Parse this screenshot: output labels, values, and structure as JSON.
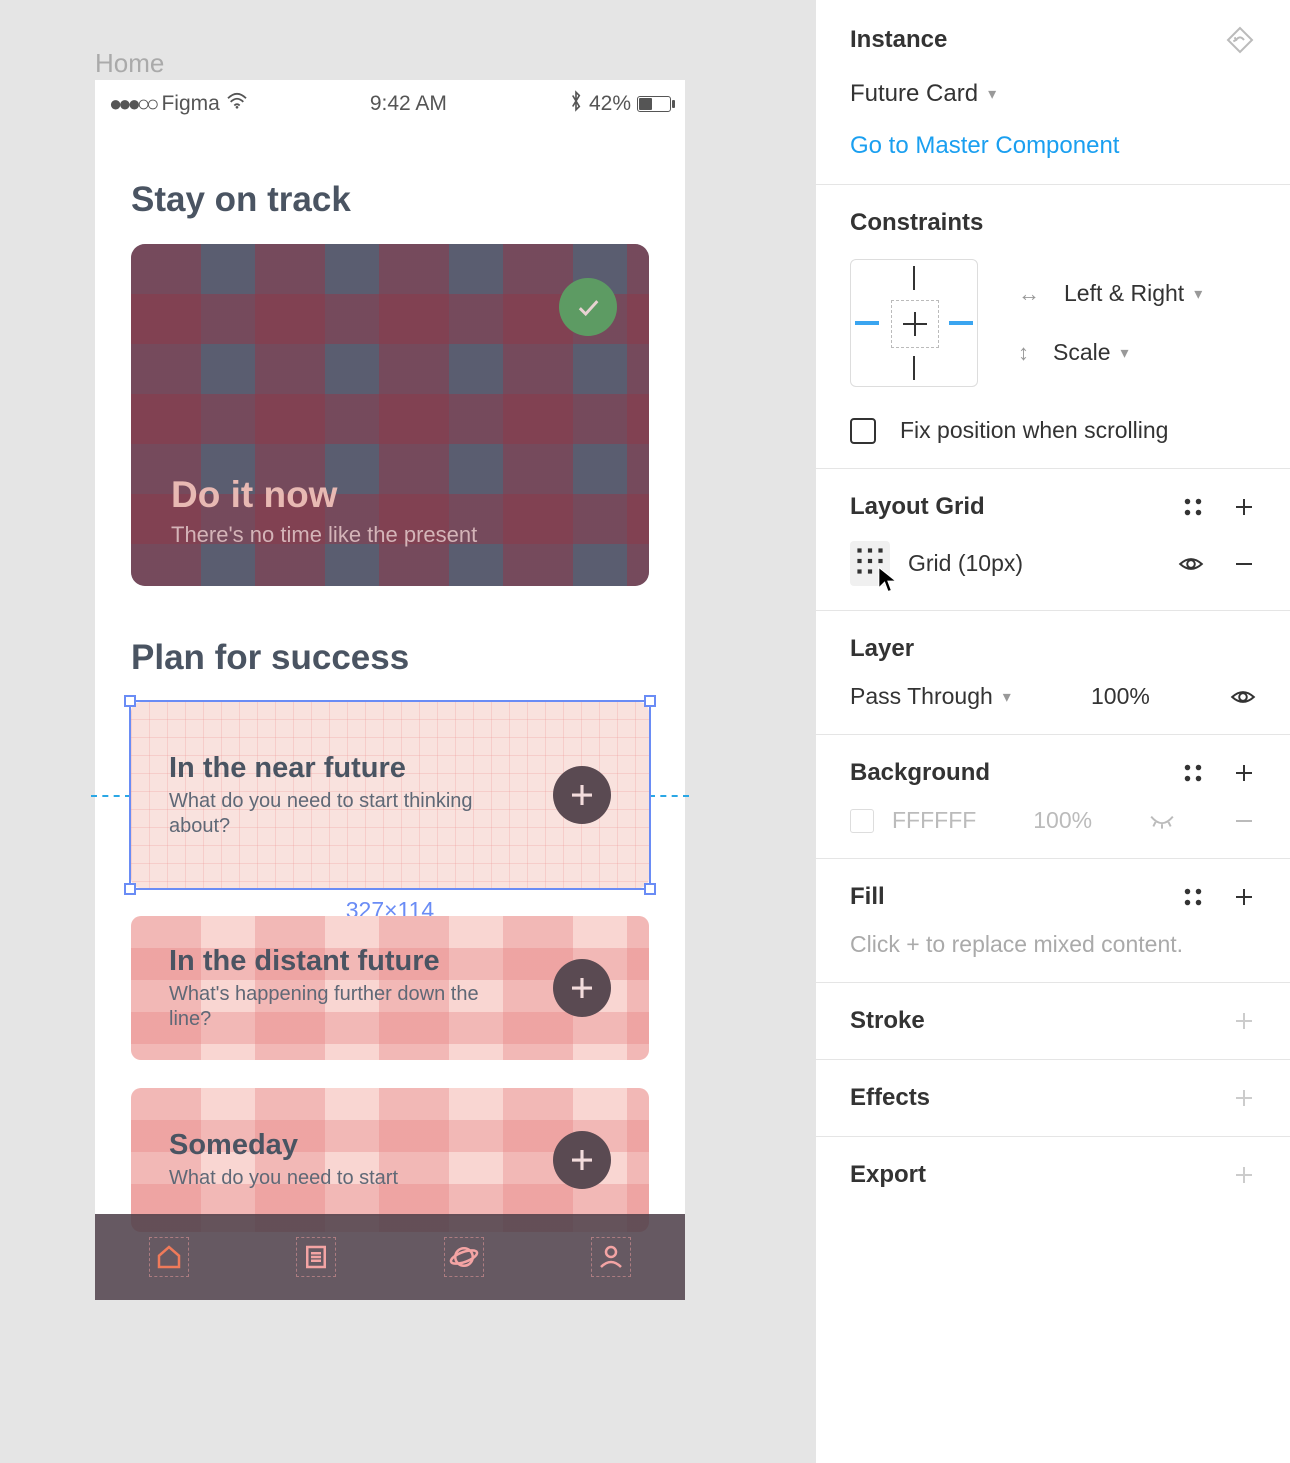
{
  "canvas": {
    "frame_label": "Home",
    "status": {
      "carrier": "Figma",
      "time": "9:42 AM",
      "battery": "42%"
    },
    "section1_title": "Stay on track",
    "hero": {
      "title": "Do it now",
      "subtitle": "There's no time like the present"
    },
    "section2_title": "Plan for success",
    "cards": [
      {
        "title": "In the near future",
        "subtitle": "What do you need to start thinking about?"
      },
      {
        "title": "In the distant future",
        "subtitle": "What's happening further down the line?"
      },
      {
        "title": "Someday",
        "subtitle": "What do you need to start"
      }
    ],
    "selection_dims": "327×114"
  },
  "panel": {
    "instance": {
      "header": "Instance",
      "component": "Future Card",
      "master_link": "Go to Master Component"
    },
    "constraints": {
      "header": "Constraints",
      "horizontal": "Left & Right",
      "vertical": "Scale",
      "fix_label": "Fix position when scrolling"
    },
    "layout_grid": {
      "header": "Layout Grid",
      "item": "Grid (10px)"
    },
    "layer": {
      "header": "Layer",
      "blend": "Pass Through",
      "opacity": "100%"
    },
    "background": {
      "header": "Background",
      "hex": "FFFFFF",
      "opacity": "100%"
    },
    "fill": {
      "header": "Fill",
      "hint": "Click + to replace mixed content."
    },
    "stroke": {
      "header": "Stroke"
    },
    "effects": {
      "header": "Effects"
    },
    "export": {
      "header": "Export"
    }
  }
}
